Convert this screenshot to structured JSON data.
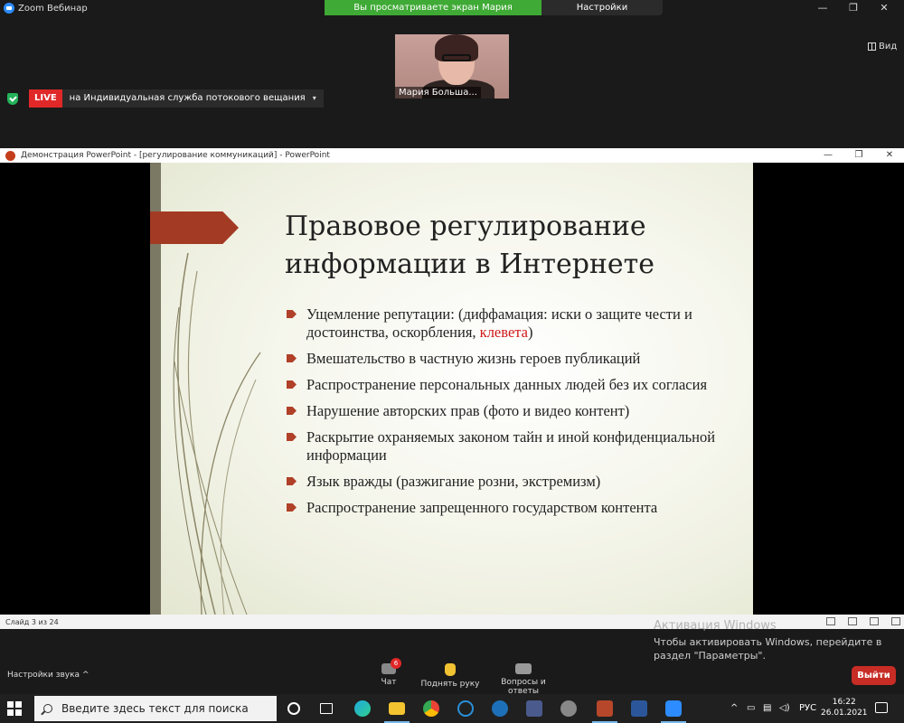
{
  "zoom": {
    "app_title": "Zoom Вебинар",
    "share_banner": "Вы просматриваете экран Мария Большакова",
    "view_options": "Настройки просмотра",
    "view_options_caret": "⌄",
    "view_button": "Вид",
    "participant_name": "Мария Большa...",
    "live_badge": "LIVE",
    "live_service": "на Индивидуальная служба потокового вещания",
    "live_caret": "▾"
  },
  "powerpoint": {
    "window_title": "Демонстрация PowerPoint - [регулирование коммуникаций] - PowerPoint",
    "slide_title_line1": "Правовое регулирование",
    "slide_title_line2": "информации в Интернете",
    "bullets": [
      {
        "text": "Ущемление репутации: (диффамация: иски о защите чести и достоинства, оскорбления, ",
        "highlight": "клевета",
        "after": ")"
      },
      {
        "text": "Вмешательство в частную жизнь героев публикаций"
      },
      {
        "text": "Распространение персональных данных людей без их согласия"
      },
      {
        "text": "Нарушение авторских прав (фото и видео контент)"
      },
      {
        "text": "Раскрытие охраняемых законом тайн и иной конфиденциальной информации"
      },
      {
        "text": "Язык вражды (разжигание розни, экстремизм)"
      },
      {
        "text": "Распространение запрещенного государством контента"
      }
    ],
    "status_slide": "Слайд 3 из 24",
    "accent_color": "#a33a24",
    "highlight_color": "#d01818"
  },
  "windows_activation": {
    "line1": "Активация Windows",
    "line2": "Чтобы активировать Windows, перейдите в раздел \"Параметры\"."
  },
  "zoom_controls": {
    "audio_settings": "Настройки звука",
    "audio_caret": "^",
    "chat_label": "Чат",
    "chat_badge": "6",
    "raise_hand_label": "Поднять руку",
    "qa_label": "Вопросы и ответы",
    "exit_label": "Выйти"
  },
  "taskbar": {
    "search_placeholder": "Введите здесь текст для поиска",
    "language": "РУС",
    "time": "16:22",
    "date": "26.01.2021"
  }
}
